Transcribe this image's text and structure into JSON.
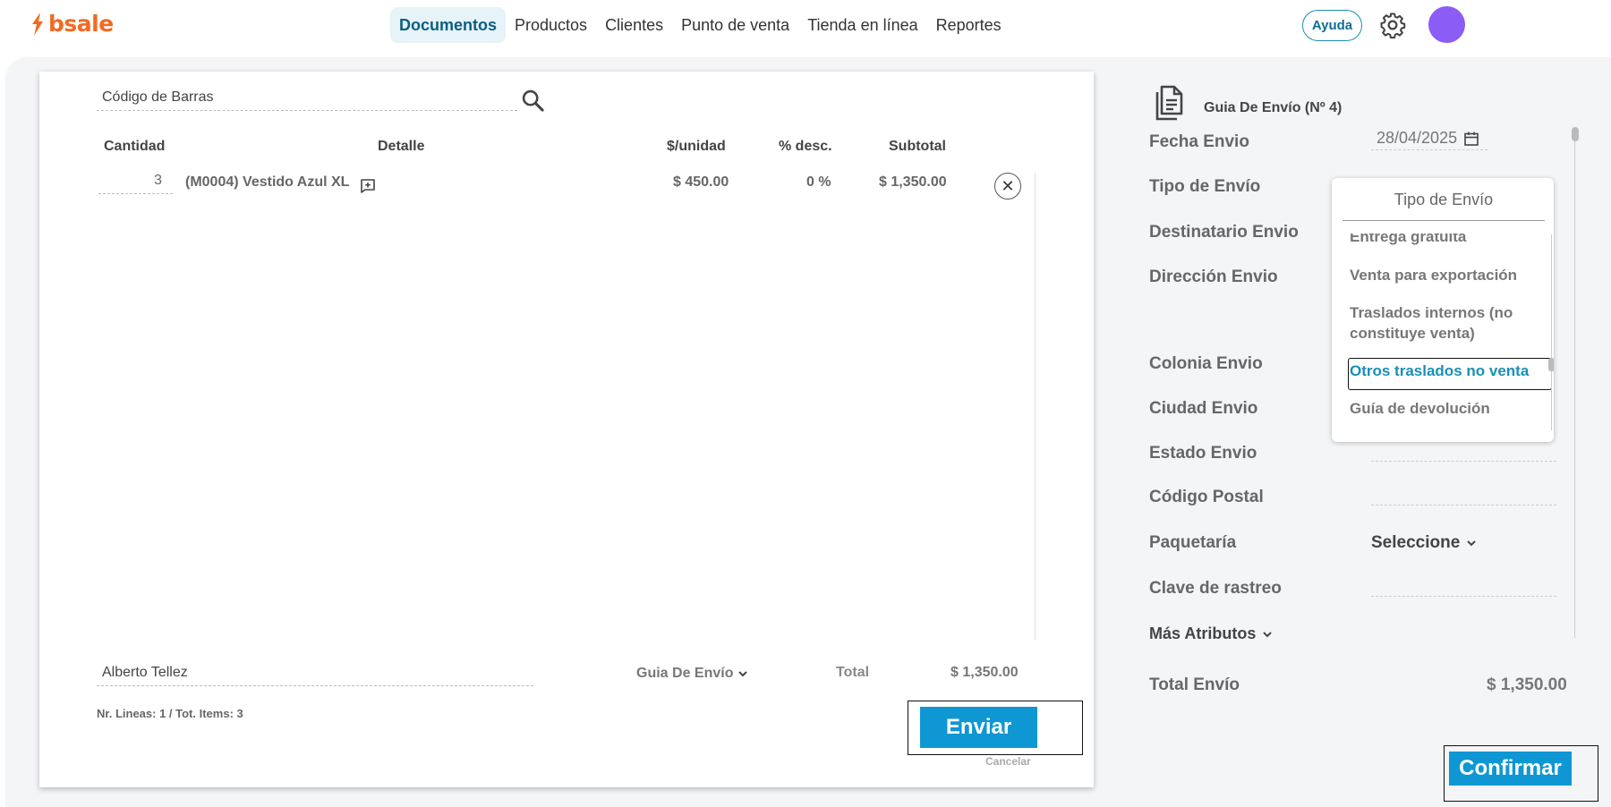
{
  "brand": {
    "name": "bsale",
    "color": "#f26a21"
  },
  "nav": {
    "items": [
      "Documentos",
      "Productos",
      "Clientes",
      "Punto de venta",
      "Tienda en línea",
      "Reportes"
    ],
    "active": "Documentos",
    "help_label": "Ayuda",
    "accent": "#0f97d3"
  },
  "editor": {
    "barcode_placeholder": "Código de Barras",
    "columns": [
      "Cantidad",
      "Detalle",
      "$/unidad",
      "% desc.",
      "Subtotal"
    ],
    "rows": [
      {
        "qty": "3",
        "detail": "(M0004) Vestido Azul XL",
        "unit": "$ 450.00",
        "discount": "0 %",
        "subtotal": "$ 1,350.00"
      }
    ],
    "client": "Alberto Tellez",
    "document_type": "Guia De Envío",
    "total_label": "Total",
    "total_value": "$ 1,350.00",
    "lines_info": "Nr. Lineas: 1 / Tot. Items: 3",
    "send_label": "Enviar",
    "cancel_label": "Cancelar"
  },
  "shipping": {
    "title": "Guia De Envío (Nº 4)",
    "fields": {
      "fecha": "Fecha Envio",
      "tipo": "Tipo de Envío",
      "destinatario": "Destinatario Envio",
      "direccion": "Dirección Envio",
      "colonia": "Colonia Envio",
      "ciudad": "Ciudad Envio",
      "estado": "Estado Envio",
      "cp": "Código Postal",
      "paqueteria": "Paquetaría",
      "clave": "Clave de rastreo"
    },
    "date_value": "28/04/2025",
    "carrier_placeholder": "Seleccione",
    "more_attributes": "Más Atributos",
    "total_label": "Total Envío",
    "total_value": "$ 1,350.00",
    "confirm_label": "Confirmar",
    "dropdown": {
      "title": "Tipo de Envío",
      "options": [
        "Entrega gratuita",
        "Venta para exportación",
        "Traslados internos (no constituye venta)",
        "Otros traslados no venta",
        "Guía de devolución"
      ],
      "selected": "Otros traslados no venta"
    }
  }
}
